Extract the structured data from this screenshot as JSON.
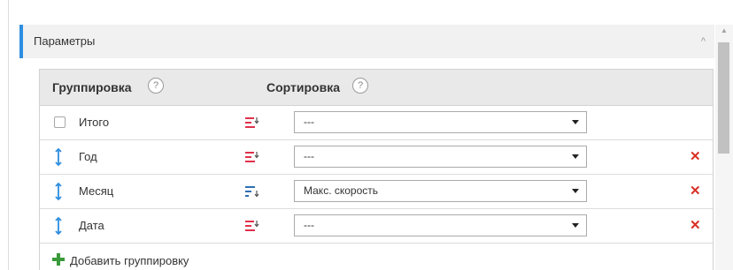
{
  "panel": {
    "title": "Параметры",
    "collapse_glyph": "^"
  },
  "columns": {
    "grouping": "Группировка",
    "sorting": "Сортировка",
    "help_glyph": "?"
  },
  "rows": [
    {
      "label": "Итого",
      "control": "checkbox",
      "sort_icon": "sort-red-icon",
      "sort_value": "---",
      "removable": false
    },
    {
      "label": "Год",
      "control": "drag-handle",
      "sort_icon": "sort-red-icon",
      "sort_value": "---",
      "removable": true
    },
    {
      "label": "Месяц",
      "control": "drag-handle",
      "sort_icon": "sort-blue-icon",
      "sort_value": "Макс. скорость",
      "removable": true
    },
    {
      "label": "Дата",
      "control": "drag-handle",
      "sort_icon": "sort-red-icon",
      "sort_value": "---",
      "removable": true
    }
  ],
  "remove_glyph": "✕",
  "add_label": "Добавить группировку",
  "colors": {
    "accent": "#2e8ee0",
    "sort_red": "#e0314b",
    "sort_blue": "#2d6fb3",
    "remove": "#d93025",
    "add": "#3a9a3a"
  }
}
